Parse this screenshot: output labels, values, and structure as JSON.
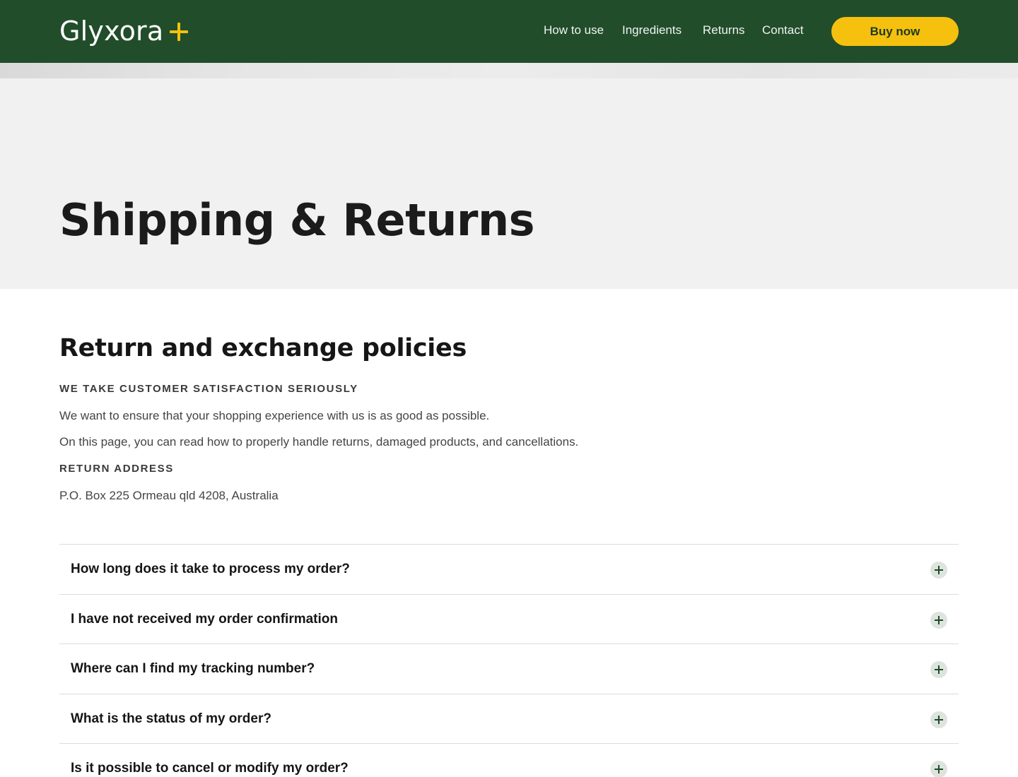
{
  "header": {
    "logo_text": "Glyxora",
    "nav": [
      {
        "label": "How to use"
      },
      {
        "label": "Ingredients"
      },
      {
        "label": "Returns"
      },
      {
        "label": "Contact"
      }
    ],
    "cta_label": "Buy now"
  },
  "hero": {
    "title": "Shipping & Returns"
  },
  "policies": {
    "heading": "Return and exchange policies",
    "eyebrow_1": "WE TAKE CUSTOMER SATISFACTION SERIOUSLY",
    "paragraph_1": "We want to ensure that your shopping experience with us is as good as possible.",
    "paragraph_2": "On this page, you can read how to properly handle returns, damaged products, and cancellations.",
    "eyebrow_2": "RETURN ADDRESS",
    "address": "P.O. Box 225 Ormeau qld 4208, Australia"
  },
  "faq": [
    {
      "question": "How long does it take to process my order?"
    },
    {
      "question": "I have not received my order confirmation"
    },
    {
      "question": "Where can I find my tracking number?"
    },
    {
      "question": "What is the status of my order?"
    },
    {
      "question": "Is it possible to cancel or modify my order?"
    }
  ],
  "colors": {
    "header_bg": "#214d2b",
    "accent": "#f5c10e",
    "hero_bg": "#f1f1f1"
  }
}
